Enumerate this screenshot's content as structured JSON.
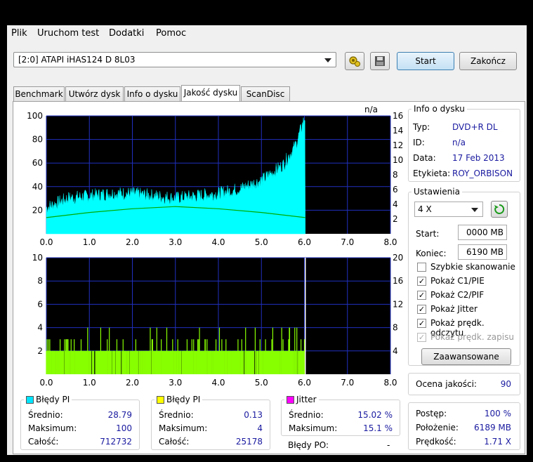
{
  "menu": [
    "Plik",
    "Uruchom test",
    "Dodatki",
    "Pomoc"
  ],
  "device": {
    "selected": "[2:0]   ATAPI iHAS124   D 8L03"
  },
  "buttons": {
    "start": "Start",
    "exit": "Zakończ",
    "advanced": "Zaawansowane"
  },
  "tabs": [
    "Benchmark",
    "Utwórz dysk",
    "Info o dysku",
    "Jakość dysku",
    "ScanDisc"
  ],
  "disc_info": {
    "title": "Info o dysku",
    "type_label": "Typ:",
    "type": "DVD+R DL",
    "id_label": "ID:",
    "id": "n/a",
    "date_label": "Data:",
    "date": "17 Feb 2013",
    "label_label": "Etykieta:",
    "label": "ROY_ORBISON"
  },
  "settings": {
    "title": "Ustawienia",
    "speed": "4 X",
    "start_label": "Start:",
    "start": "0000 MB",
    "end_label": "Koniec:",
    "end": "6190 MB",
    "checks": [
      {
        "label": "Szybkie skanowanie",
        "checked": false,
        "disabled": false
      },
      {
        "label": "Pokaż C1/PIE",
        "checked": true,
        "disabled": false
      },
      {
        "label": "Pokaż C2/PIF",
        "checked": true,
        "disabled": false
      },
      {
        "label": "Pokaż Jitter",
        "checked": true,
        "disabled": false
      },
      {
        "label": "Pokaż prędk. odczytu",
        "checked": true,
        "disabled": false
      },
      {
        "label": "Pokaż prędk. zapisu",
        "checked": true,
        "disabled": true
      }
    ]
  },
  "quality": {
    "label": "Ocena jakości:",
    "value": "90"
  },
  "progress": {
    "progress_label": "Postęp:",
    "progress": "100 %",
    "position_label": "Położenie:",
    "position": "6189 MB",
    "speed_label": "Prędkość:",
    "speed": "1.71 X"
  },
  "stats": {
    "pi": {
      "title": "Błędy PI",
      "avg_label": "Średnio:",
      "avg": "28.79",
      "max_label": "Maksimum:",
      "max": "100",
      "total_label": "Całość:",
      "total": "712732",
      "color": "#00e5ff"
    },
    "pif": {
      "title": "Błędy PI",
      "avg_label": "Średnio:",
      "avg": "0.13",
      "max_label": "Maksimum:",
      "max": "4",
      "total_label": "Całość:",
      "total": "25178",
      "color": "#ffff00"
    },
    "jitter": {
      "title": "Jitter",
      "avg_label": "Średnio:",
      "avg": "15.02 %",
      "max_label": "Maksimum:",
      "max": "15.1 %",
      "color": "#ff00ff"
    },
    "po_label": "Błędy PO:",
    "po": "-"
  },
  "chart_data": [
    {
      "type": "area",
      "title": "n/a",
      "x_ticks": [
        "0.0",
        "1.0",
        "2.0",
        "3.0",
        "4.0",
        "5.0",
        "6.0",
        "7.0",
        "8.0"
      ],
      "y_ticks_left": [
        "100",
        "80",
        "60",
        "40",
        "20"
      ],
      "y_ticks_right": [
        "16",
        "14",
        "12",
        "10",
        "8",
        "6",
        "4",
        "2"
      ],
      "xlim": [
        0,
        8
      ],
      "ylim": [
        0,
        100
      ],
      "y2lim": [
        0,
        16
      ],
      "series": [
        {
          "name": "PI errors",
          "color": "#00ffff",
          "x": [
            0.0,
            0.5,
            1.0,
            1.5,
            2.0,
            2.5,
            3.0,
            3.5,
            4.0,
            4.5,
            5.0,
            5.5,
            5.8,
            5.95,
            6.02
          ],
          "values": [
            22,
            30,
            32,
            34,
            34,
            32,
            30,
            32,
            34,
            38,
            45,
            58,
            75,
            92,
            100
          ]
        },
        {
          "name": "Read speed",
          "color": "#00aa00",
          "x": [
            0.0,
            1.0,
            2.0,
            3.0,
            4.0,
            5.0,
            6.02
          ],
          "values": [
            2.2,
            2.9,
            3.4,
            3.7,
            3.4,
            2.9,
            2.2
          ]
        }
      ],
      "data_end": 6.02
    },
    {
      "type": "bar",
      "x_ticks": [
        "0.0",
        "1.0",
        "2.0",
        "3.0",
        "4.0",
        "5.0",
        "6.0",
        "7.0",
        "8.0"
      ],
      "y_ticks_left": [
        "10",
        "8",
        "6",
        "4",
        "2"
      ],
      "y_ticks_right": [
        "20",
        "16",
        "12",
        "8",
        "4"
      ],
      "xlim": [
        0,
        8
      ],
      "ylim": [
        0,
        10
      ],
      "y2lim": [
        0,
        20
      ],
      "series": [
        {
          "name": "PIF errors",
          "color": "#88ff00",
          "typical": 2,
          "max": 4
        },
        {
          "name": "Jitter",
          "color": "#ff00ff",
          "values": []
        }
      ],
      "data_end": 6.02
    }
  ]
}
